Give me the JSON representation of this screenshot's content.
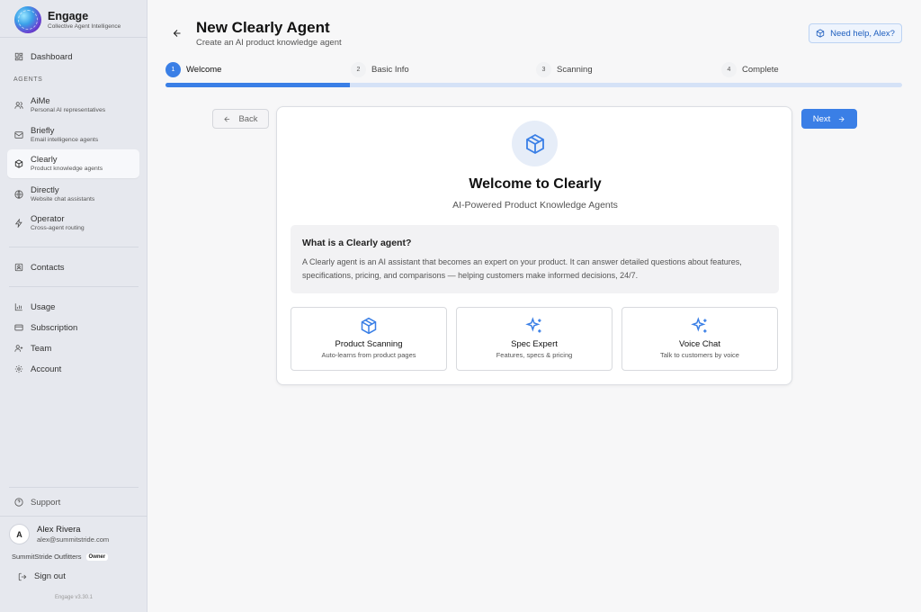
{
  "brand": {
    "name": "Engage",
    "tagline": "Collective Agent Intelligence"
  },
  "sidebar": {
    "dashboard": "Dashboard",
    "section_agents": "AGENTS",
    "agents": [
      {
        "label": "AiMe",
        "sub": "Personal AI representatives",
        "icon": "users-icon"
      },
      {
        "label": "Briefly",
        "sub": "Email intelligence agents",
        "icon": "mail-icon"
      },
      {
        "label": "Clearly",
        "sub": "Product knowledge agents",
        "icon": "package-icon"
      },
      {
        "label": "Directly",
        "sub": "Website chat assistants",
        "icon": "globe-icon"
      },
      {
        "label": "Operator",
        "sub": "Cross-agent routing",
        "icon": "zap-icon"
      }
    ],
    "contacts": "Contacts",
    "usage": "Usage",
    "subscription": "Subscription",
    "team": "Team",
    "account": "Account",
    "support": "Support",
    "user": {
      "initial": "A",
      "name": "Alex Rivera",
      "email": "alex@summitstride.com"
    },
    "org": {
      "name": "SummitStride Outfitters",
      "role": "Owner"
    },
    "signout": "Sign out",
    "version": "Engage v3.30.1"
  },
  "header": {
    "title": "New Clearly Agent",
    "subtitle": "Create an AI product knowledge agent",
    "help": "Need help, Alex?"
  },
  "steps": [
    {
      "num": "1",
      "label": "Welcome"
    },
    {
      "num": "2",
      "label": "Basic Info"
    },
    {
      "num": "3",
      "label": "Scanning"
    },
    {
      "num": "4",
      "label": "Complete"
    }
  ],
  "progress": {
    "current_step": 1,
    "total_steps": 4,
    "fraction": 0.25
  },
  "nav": {
    "back": "Back",
    "next": "Next"
  },
  "card": {
    "title": "Welcome to Clearly",
    "subtitle": "AI-Powered Product Knowledge Agents",
    "info_title": "What is a Clearly agent?",
    "info_text": "A Clearly agent is an AI assistant that becomes an expert on your product. It can answer detailed questions about features, specifications, pricing, and comparisons — helping customers make informed decisions, 24/7.",
    "features": [
      {
        "title": "Product Scanning",
        "sub": "Auto-learns from product pages",
        "icon": "package-icon"
      },
      {
        "title": "Spec Expert",
        "sub": "Features, specs & pricing",
        "icon": "sparkles-icon"
      },
      {
        "title": "Voice Chat",
        "sub": "Talk to customers by voice",
        "icon": "sparkles-icon"
      }
    ]
  },
  "colors": {
    "accent": "#3a7fe6",
    "sidebar_bg": "#e6e8ee",
    "progress_track": "#d5e2f7"
  }
}
